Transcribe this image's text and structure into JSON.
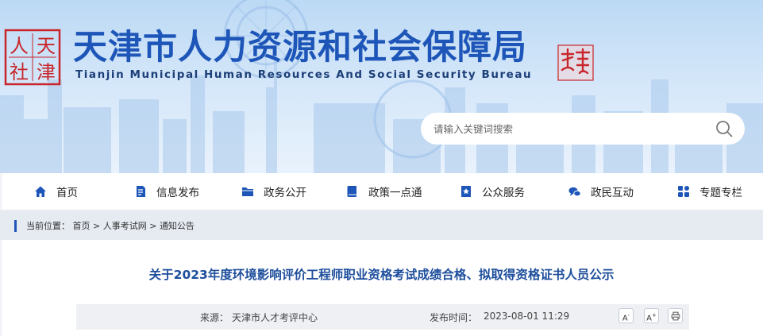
{
  "header": {
    "title": "天津市人力资源和社会保障局",
    "subtitle": "Tianjin Municipal Human Resources And Social Security Bureau",
    "logo_chars": [
      "人",
      "天",
      "社",
      "津"
    ],
    "brand_color": "#1d56b8",
    "seal_color": "#c8262b"
  },
  "search": {
    "placeholder": "请输入关键词搜索",
    "value": ""
  },
  "nav": {
    "items": [
      {
        "label": "首页",
        "icon": "home-icon"
      },
      {
        "label": "信息发布",
        "icon": "document-icon"
      },
      {
        "label": "政务公开",
        "icon": "folder-icon"
      },
      {
        "label": "政策一点通",
        "icon": "book-icon"
      },
      {
        "label": "公众服务",
        "icon": "star-bookmark-icon"
      },
      {
        "label": "政民互动",
        "icon": "chat-bubbles-icon"
      },
      {
        "label": "专题专栏",
        "icon": "grid-icon"
      }
    ]
  },
  "breadcrumb": {
    "prefix": "当前位置：",
    "items": [
      "首页",
      "人事考试网",
      "通知公告"
    ],
    "separator": " > "
  },
  "article": {
    "title": "关于2023年度环境影响评价工程师职业资格考试成绩合格、拟取得资格证书人员公示",
    "source_label": "来源：",
    "source_value": "天津市人才考评中心",
    "time_label": "发布时间：",
    "time_value": "2023-08-01 11:29",
    "font_smaller": "A",
    "font_larger": "A"
  }
}
